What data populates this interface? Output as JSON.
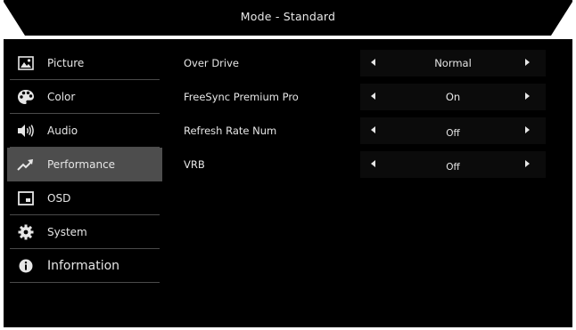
{
  "header": {
    "title": "Mode - Standard"
  },
  "sidebar": {
    "items": [
      {
        "label": "Picture",
        "icon": "picture-icon"
      },
      {
        "label": "Color",
        "icon": "palette-icon"
      },
      {
        "label": "Audio",
        "icon": "speaker-icon"
      },
      {
        "label": "Performance",
        "icon": "trend-up-icon",
        "active": true
      },
      {
        "label": "OSD",
        "icon": "osd-window-icon"
      },
      {
        "label": "System",
        "icon": "gear-icon"
      },
      {
        "label": "Information",
        "icon": "info-icon"
      }
    ]
  },
  "settings": {
    "rows": [
      {
        "label": "Over Drive",
        "value": "Normal"
      },
      {
        "label": "FreeSync Premium Pro",
        "value": "On"
      },
      {
        "label": "Refresh Rate Num",
        "value": "Off"
      },
      {
        "label": "VRB",
        "value": "Off"
      }
    ]
  },
  "colors": {
    "background": "#000000",
    "active_item": "#4d4d4d",
    "text": "#e6e6e6",
    "divider": "#4a4a4a"
  }
}
